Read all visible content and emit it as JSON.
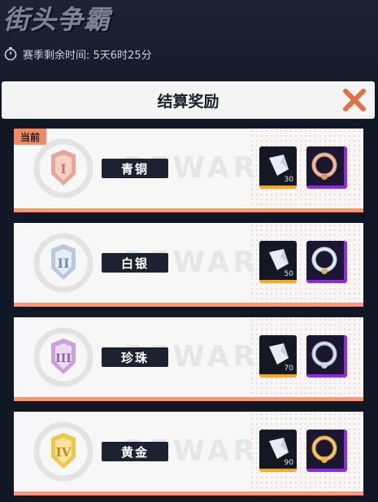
{
  "header": {
    "title": "街头争霸",
    "season_remaining": "赛季剩余时间: 5天6时25分"
  },
  "panel": {
    "title": "结算奖励"
  },
  "current_badge": "当前",
  "watermark": "REWARD",
  "tiers": [
    {
      "name": "青铜",
      "numeral": "I",
      "gem_qty": "30",
      "emblem_color": "#e7a595"
    },
    {
      "name": "白银",
      "numeral": "II",
      "gem_qty": "50",
      "emblem_color": "#b9c9dc"
    },
    {
      "name": "珍珠",
      "numeral": "III",
      "gem_qty": "70",
      "emblem_color": "#c9a2d9"
    },
    {
      "name": "黄金",
      "numeral": "IV",
      "gem_qty": "90",
      "emblem_color": "#efc64a"
    }
  ],
  "colors": {
    "card_accent": "#f29a7e",
    "gem_border": "#f5a623",
    "ring_border": "#8a2be2",
    "close_icon": "#e0703e"
  }
}
